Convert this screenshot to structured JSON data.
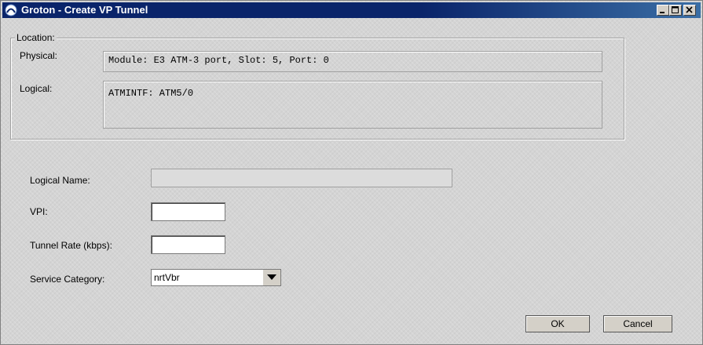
{
  "window": {
    "title": "Groton - Create VP Tunnel",
    "titlebar_color": "#0a246a",
    "controls": [
      "minimize-icon",
      "maximize-icon",
      "close-icon"
    ]
  },
  "location": {
    "legend": "Location:",
    "physical_label": "Physical:",
    "physical_value": "Module: E3 ATM-3 port, Slot: 5, Port: 0",
    "logical_label": "Logical:",
    "logical_value": "ATMINTF: ATM5/0"
  },
  "form": {
    "logical_name_label": "Logical Name:",
    "logical_name_value": "",
    "vpi_label": "VPI:",
    "vpi_value": "",
    "tunnel_rate_label": "Tunnel Rate (kbps):",
    "tunnel_rate_value": "",
    "service_category_label": "Service Category:",
    "service_category_value": "nrtVbr"
  },
  "buttons": {
    "ok": "OK",
    "cancel": "Cancel"
  }
}
